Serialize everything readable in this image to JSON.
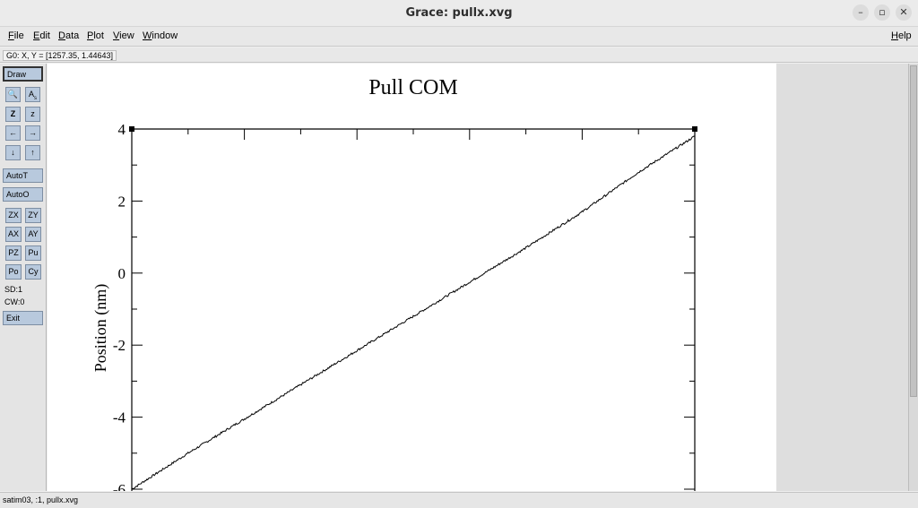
{
  "window": {
    "title": "Grace: pullx.xvg"
  },
  "menubar": {
    "items": [
      "File",
      "Edit",
      "Data",
      "Plot",
      "View",
      "Window"
    ],
    "help": "Help"
  },
  "locator": {
    "text": "G0: X, Y = [1257.35, 1.44643]"
  },
  "toolbar": {
    "draw": "Draw",
    "autot": "AutoT",
    "autoo": "AutoO",
    "zoom_pairs": [
      [
        "ZX",
        "ZY"
      ],
      [
        "AX",
        "AY"
      ],
      [
        "PZ",
        "Pu"
      ],
      [
        "Po",
        "Cy"
      ]
    ],
    "sd": "SD:1",
    "cw": "CW:0",
    "exit": "Exit"
  },
  "status": {
    "text": "satim03, :1, pullx.xvg"
  },
  "chart_data": {
    "type": "line",
    "title": "Pull COM",
    "ylabel": "Position (nm)",
    "ylim": [
      -6,
      4
    ],
    "yticks": [
      "4",
      "2",
      "0",
      "-2",
      "-4",
      "-6"
    ],
    "series": [
      {
        "x": [
          0,
          0.1,
          0.2,
          0.3,
          0.4,
          0.5,
          0.6,
          0.7,
          0.8,
          0.9,
          1.0
        ],
        "y": [
          -6.0,
          -5.0,
          -4.05,
          -3.1,
          -2.15,
          -1.2,
          -0.25,
          0.7,
          1.7,
          2.8,
          3.8
        ]
      }
    ],
    "color": "#000000"
  }
}
